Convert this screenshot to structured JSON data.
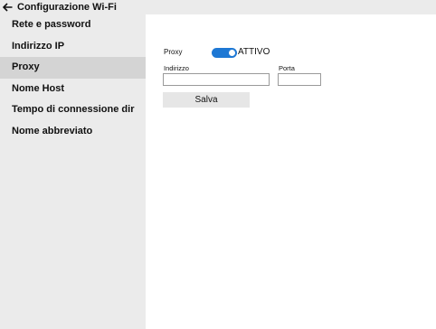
{
  "header": {
    "title": "Configurazione Wi-Fi",
    "back_icon": "arrow-left-icon"
  },
  "sidebar": {
    "items": [
      {
        "label": "Rete e password",
        "active": false
      },
      {
        "label": "Indirizzo IP",
        "active": false
      },
      {
        "label": "Proxy",
        "active": true
      },
      {
        "label": "Nome Host",
        "active": false
      },
      {
        "label": "Tempo di connessione dir",
        "active": false
      },
      {
        "label": "Nome abbreviato",
        "active": false
      }
    ]
  },
  "proxy": {
    "label": "Proxy",
    "toggle_on": true,
    "toggle_state": "ATTIVO",
    "toggle_color": "#1e78d4",
    "address_label": "Indirizzo",
    "address_value": "",
    "port_label": "Porta",
    "port_value": "",
    "save_label": "Salva"
  }
}
